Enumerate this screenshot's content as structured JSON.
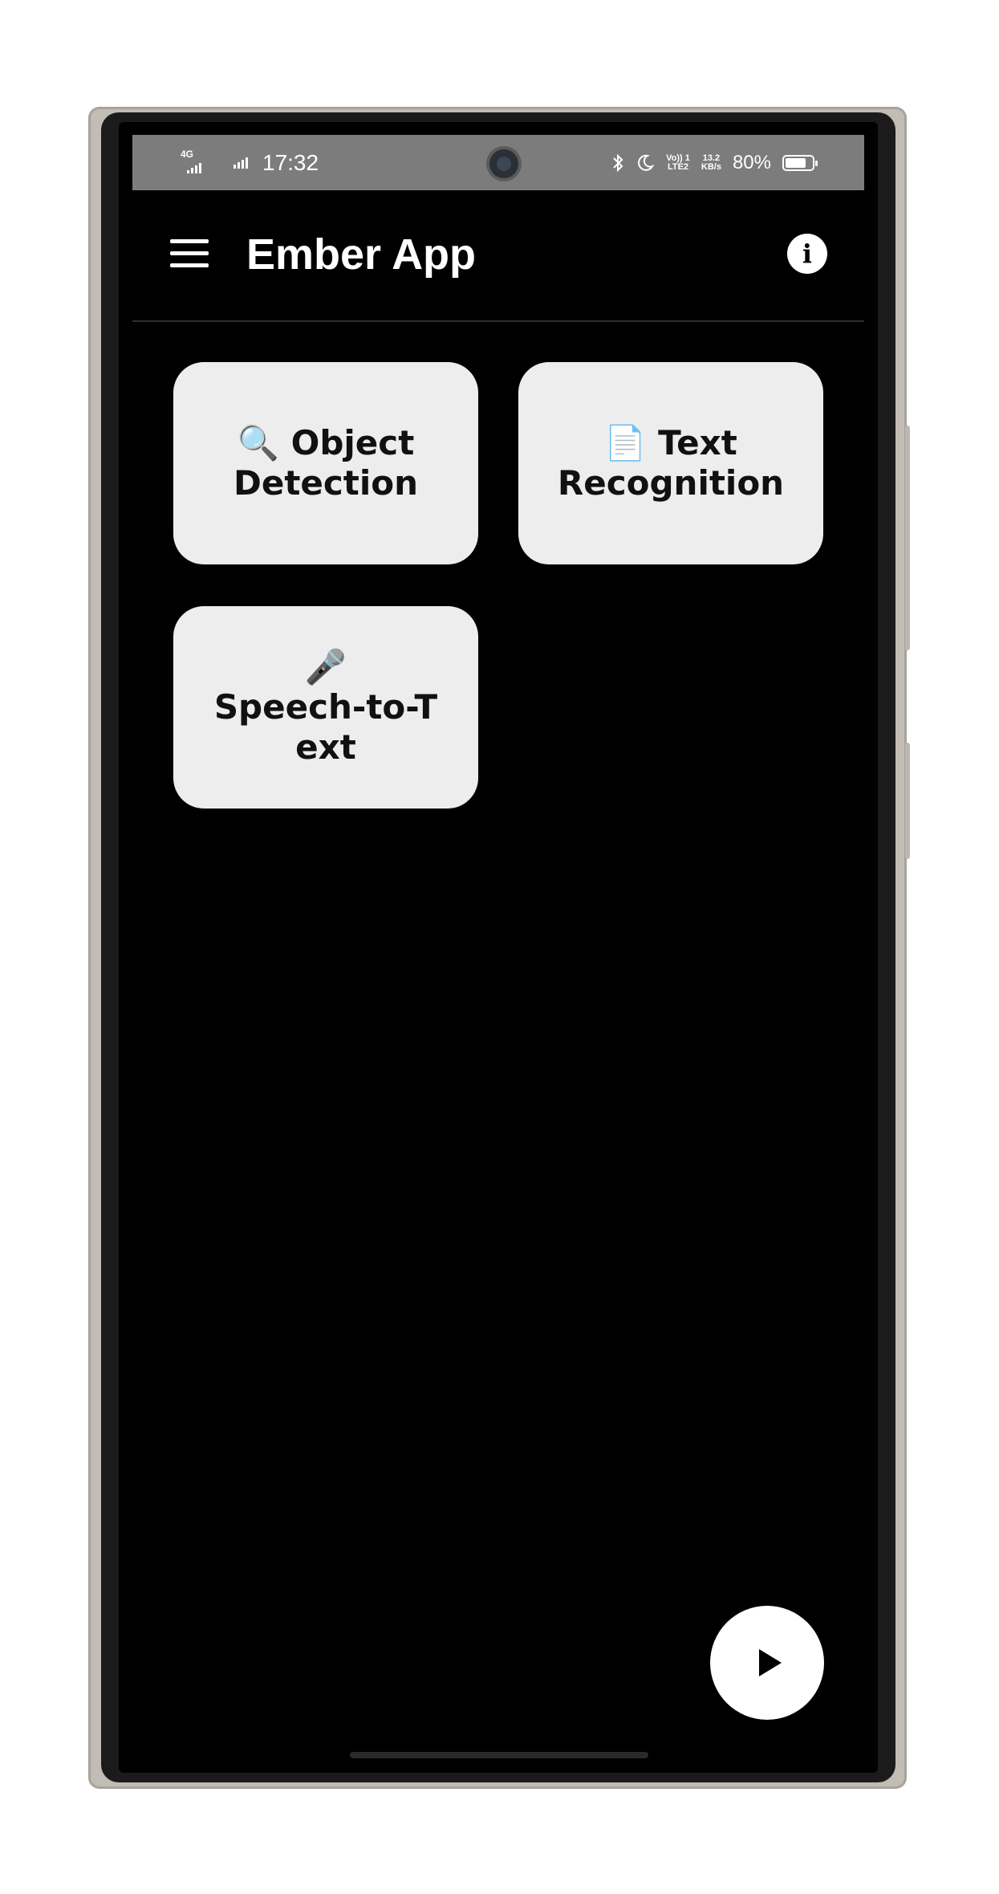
{
  "status_bar": {
    "network_label": "4G",
    "time": "17:32",
    "volte_label": "Vo)) 1\nLTE2",
    "net_speed": "13.2\nKB/s",
    "battery_percent": "80%",
    "battery_level": 0.8,
    "icons": [
      "signal-icon",
      "bluetooth-icon",
      "do-not-disturb-moon-icon",
      "battery-icon"
    ]
  },
  "app_bar": {
    "title": "Ember App",
    "menu_icon": "hamburger-menu-icon",
    "info_icon": "info-icon",
    "info_glyph": "i"
  },
  "tiles": [
    {
      "emoji": "🔍",
      "label": "Object Detection",
      "icon": "magnifier-icon"
    },
    {
      "emoji": "📄",
      "label": "Text Recognition",
      "icon": "document-icon"
    },
    {
      "emoji": "🎤",
      "label": "Speech-to-Text",
      "icon": "microphone-icon"
    }
  ],
  "fab": {
    "icon": "play-icon"
  },
  "colors": {
    "background": "#000000",
    "status_bar": "#7c7c7c",
    "tile": "#ededed",
    "text_on_dark": "#ffffff",
    "frame": "#c2bdb4"
  }
}
